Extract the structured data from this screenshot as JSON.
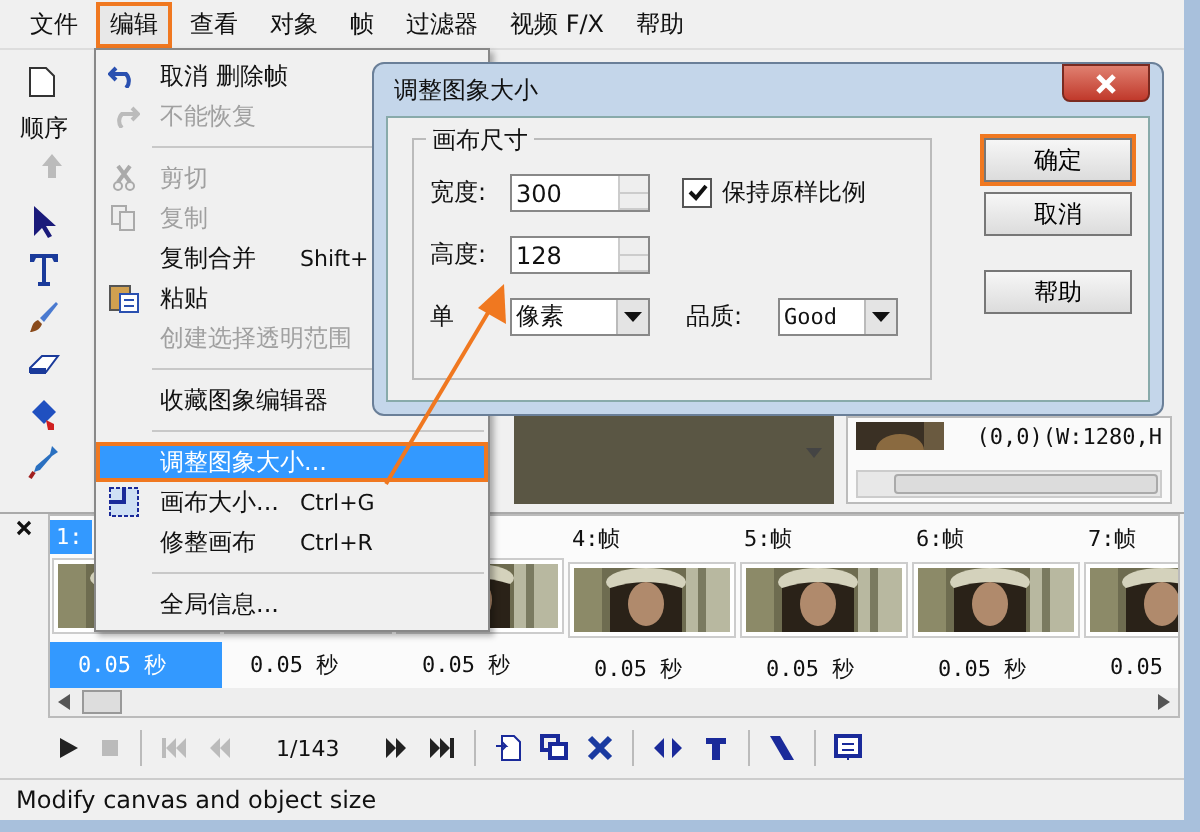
{
  "menu_bar": [
    {
      "label": "文件",
      "selected": false
    },
    {
      "label": "编辑",
      "selected": true
    },
    {
      "label": "查看",
      "selected": false
    },
    {
      "label": "对象",
      "selected": false
    },
    {
      "label": "帧",
      "selected": false
    },
    {
      "label": "过滤器",
      "selected": false
    },
    {
      "label": "视频 F/X",
      "selected": false
    },
    {
      "label": "帮助",
      "selected": false
    }
  ],
  "tool_panel": {
    "label": "顺序"
  },
  "canvas_info": "(0,0)(W:1280,H",
  "frames": [
    {
      "label": "1:",
      "duration": "0.05 秒",
      "selected": true
    },
    {
      "duration": "0.05 秒",
      "selected": false
    },
    {
      "duration": "0.05 秒",
      "selected": false
    },
    {
      "label": "4:帧",
      "duration": "0.05 秒",
      "selected": false
    },
    {
      "label": "5:帧",
      "duration": "0.05 秒",
      "selected": false
    },
    {
      "label": "6:帧",
      "duration": "0.05 秒",
      "selected": false
    },
    {
      "label": "7:帧",
      "duration": "0.05",
      "selected": false
    }
  ],
  "transport": {
    "counter": "1/143"
  },
  "status_bar": "Modify canvas and object size",
  "edit_menu": [
    {
      "kind": "item",
      "label": "取消 删除帧",
      "disabled": false,
      "selected": false
    },
    {
      "kind": "item",
      "label": "不能恢复",
      "disabled": true,
      "selected": false
    },
    {
      "kind": "separator"
    },
    {
      "kind": "item",
      "label": "剪切",
      "disabled": true,
      "selected": false
    },
    {
      "kind": "item",
      "label": "复制",
      "disabled": true,
      "selected": false
    },
    {
      "kind": "item",
      "label": "复制合并",
      "shortcut": "Shift+",
      "disabled": false,
      "selected": false
    },
    {
      "kind": "item",
      "label": "粘贴",
      "disabled": false,
      "selected": false
    },
    {
      "kind": "item",
      "label": "创建选择透明范围",
      "disabled": true,
      "selected": false
    },
    {
      "kind": "separator"
    },
    {
      "kind": "item",
      "label": "收藏图象编辑器",
      "disabled": false,
      "selected": false
    },
    {
      "kind": "separator"
    },
    {
      "kind": "item",
      "label": "调整图象大小...",
      "disabled": false,
      "selected": true
    },
    {
      "kind": "item",
      "label": "画布大小...",
      "shortcut": "Ctrl+G",
      "disabled": false,
      "selected": false
    },
    {
      "kind": "item",
      "label": "修整画布",
      "shortcut": "Ctrl+R",
      "disabled": false,
      "selected": false
    },
    {
      "kind": "separator"
    },
    {
      "kind": "item",
      "label": "全局信息...",
      "disabled": false,
      "selected": false
    }
  ],
  "dialog": {
    "title": "调整图象大小",
    "group_title": "画布尺寸",
    "width": {
      "label": "宽度:",
      "value": "300"
    },
    "height": {
      "label": "高度:",
      "value": "128"
    },
    "keep_ratio": {
      "label": "保持原样比例",
      "checked": true
    },
    "unit": {
      "label": "单",
      "value": "像素"
    },
    "quality": {
      "label": "品质:",
      "value": "Good"
    },
    "buttons": [
      {
        "label": "确定",
        "selected": true
      },
      {
        "label": "取消",
        "selected": false
      },
      {
        "label": "帮助",
        "selected": false
      }
    ]
  }
}
